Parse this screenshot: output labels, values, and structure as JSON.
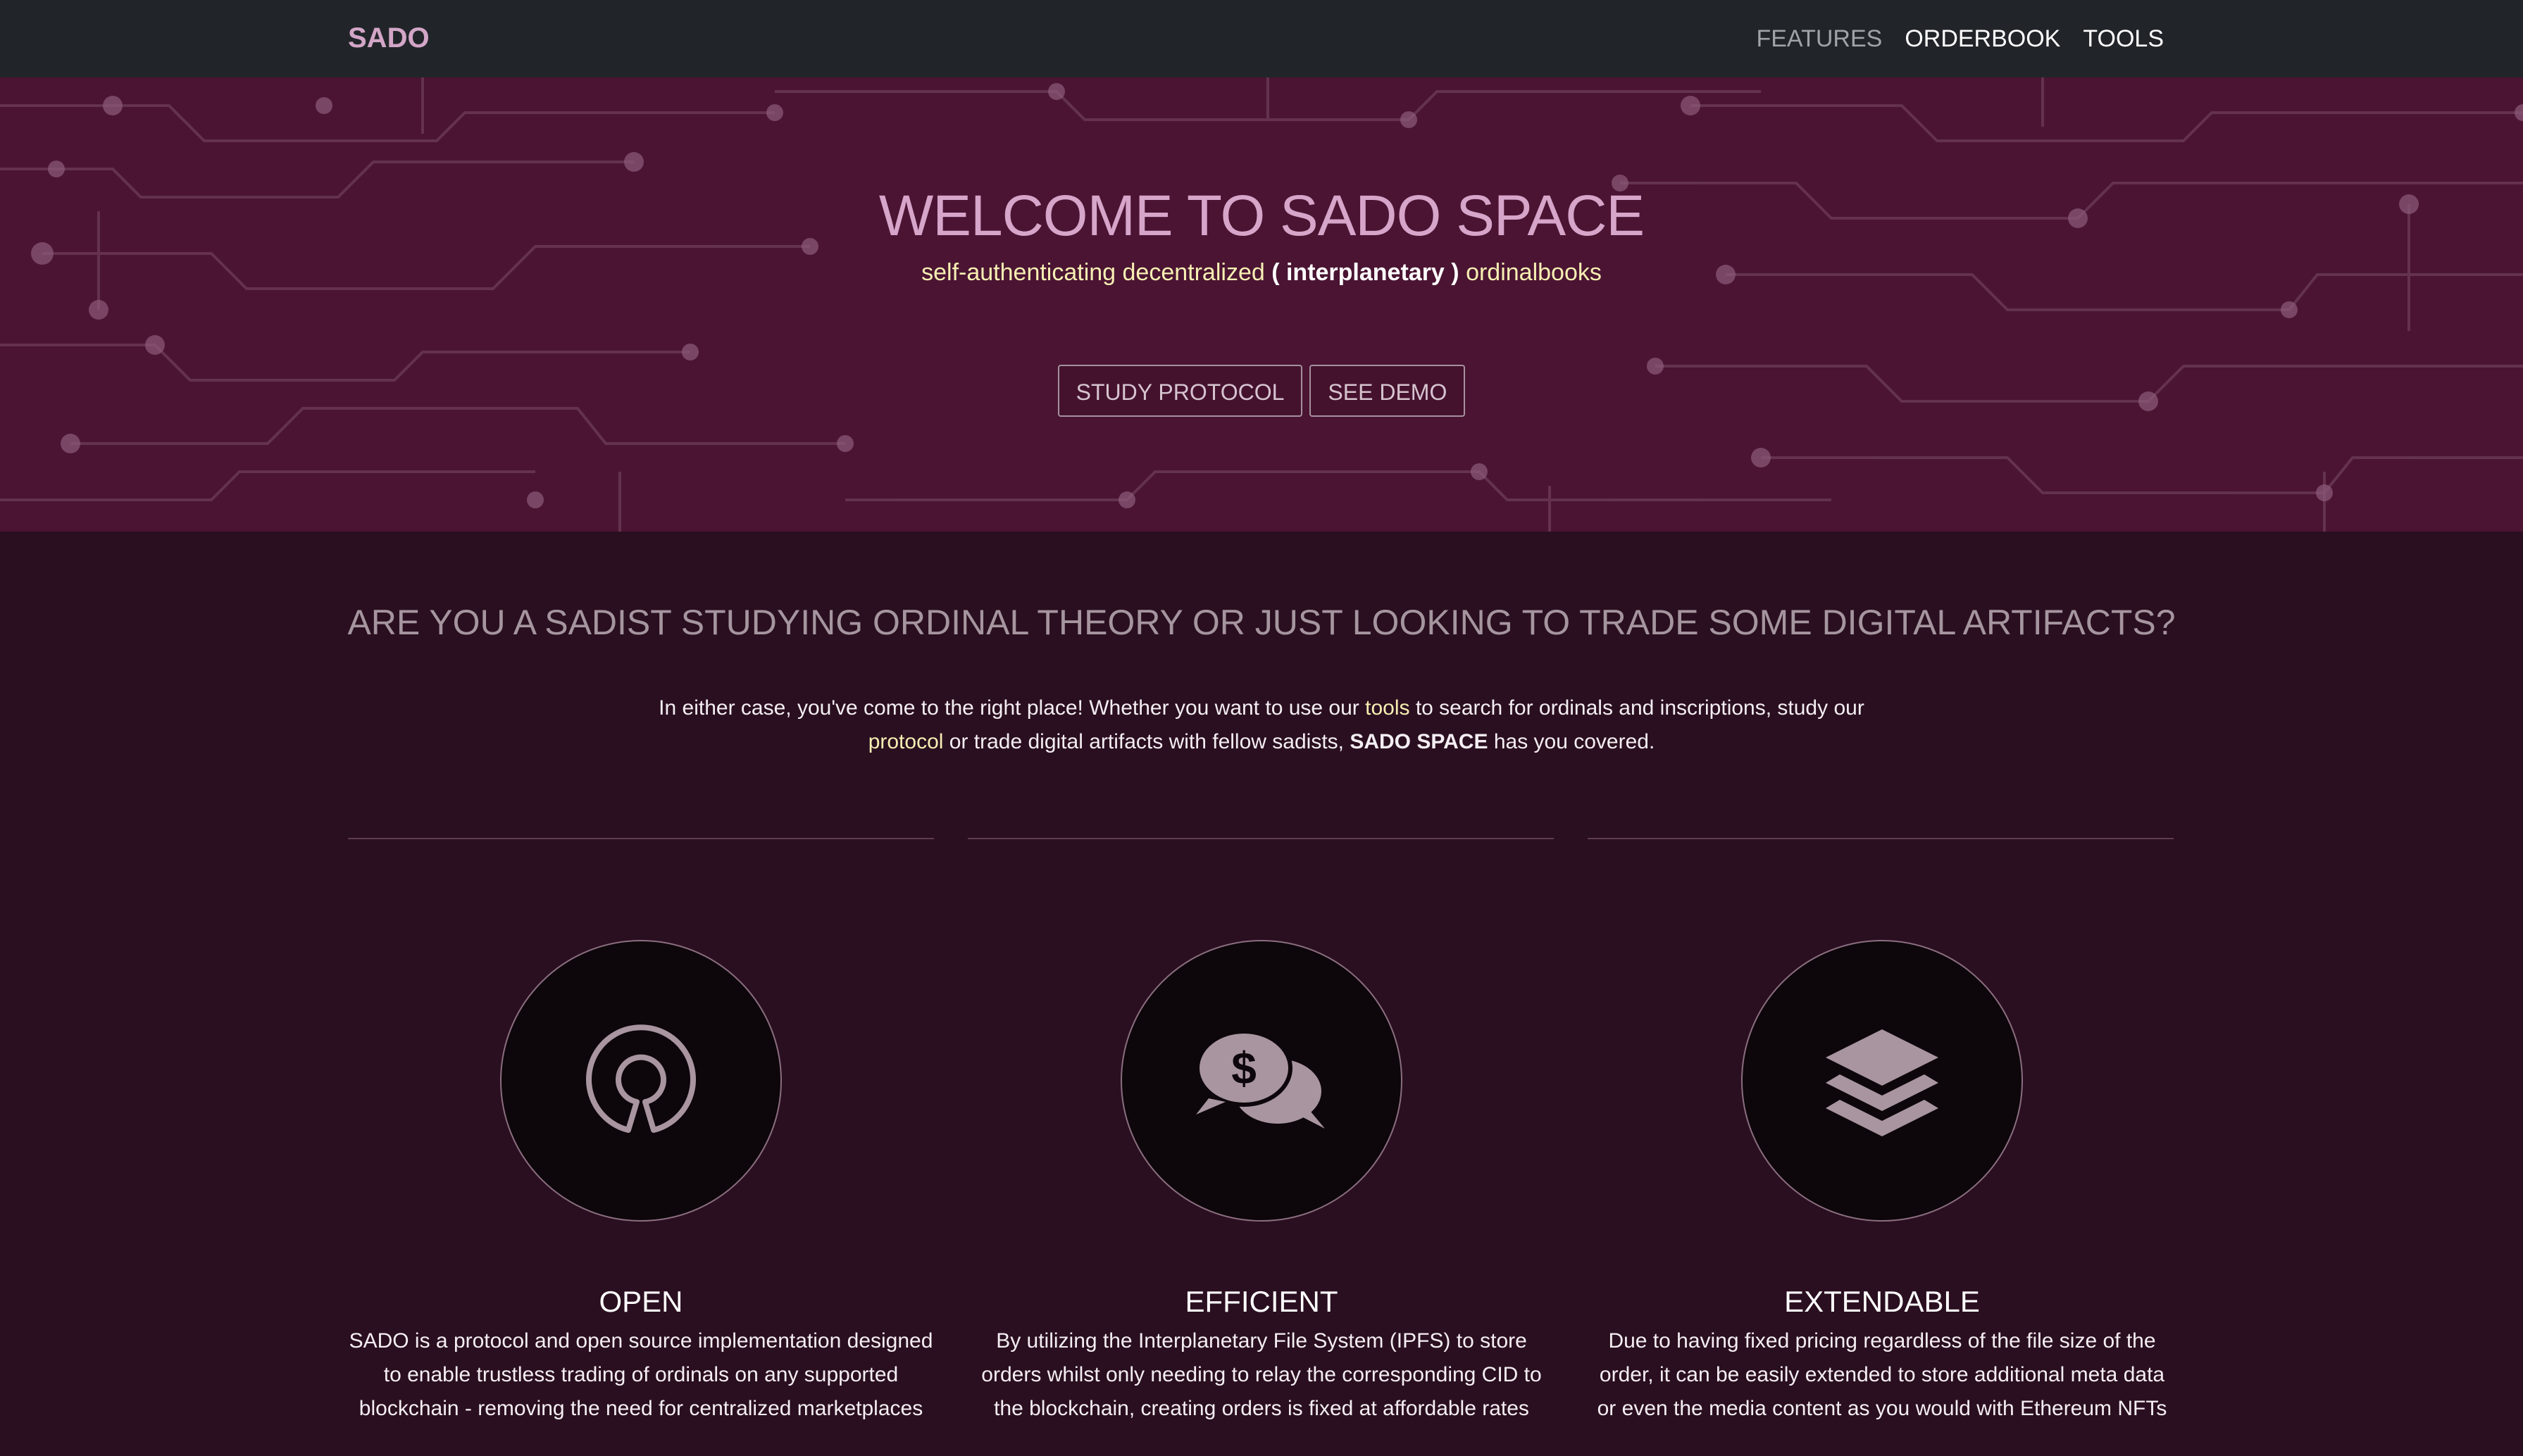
{
  "navbar": {
    "brand": "SADO",
    "links": [
      {
        "label": "FEATURES"
      },
      {
        "label": "ORDERBOOK"
      },
      {
        "label": "TOOLS"
      }
    ]
  },
  "hero": {
    "title": "WELCOME TO SADO SPACE",
    "subtitle_part1": "self-authenticating decentralized",
    "subtitle_part2": "( interplanetary )",
    "subtitle_part3": "ordinalbooks",
    "buttons": [
      {
        "label": "STUDY PROTOCOL"
      },
      {
        "label": "SEE DEMO"
      }
    ]
  },
  "intro": {
    "heading": "ARE YOU A SADIST STUDYING ORDINAL THEORY OR JUST LOOKING TO TRADE SOME DIGITAL ARTIFACTS?",
    "text1": "In either case, you've come to the right place! Whether you want to use our ",
    "link_tools": "tools",
    "text2": " to search for ordinals and inscriptions, study our ",
    "link_protocol": "protocol",
    "text3": " or trade digital artifacts with fellow sadists, ",
    "brand_bold": "SADO SPACE",
    "text4": " has you covered."
  },
  "features": [
    {
      "icon": "open-source-icon",
      "title": "OPEN",
      "text": "SADO is a protocol and open source implementation designed to enable trustless trading of ordinals on any supported blockchain - removing the need for centralized marketplaces"
    },
    {
      "icon": "dollar-chat-icon",
      "title": "EFFICIENT",
      "text": "By utilizing the Interplanetary File System (IPFS) to store orders whilst only needing to relay the corresponding CID to the blockchain, creating orders is fixed at affordable rates"
    },
    {
      "icon": "layers-icon",
      "title": "EXTENDABLE",
      "text": "Due to having fixed pricing regardless of the file size of the order, it can be easily extended to store additional meta data or even the media content as you would with Ethereum NFTs"
    }
  ],
  "colors": {
    "navbar_bg": "#212529",
    "hero_bg": "#4a1432",
    "page_bg": "#2a0f20",
    "accent_pink": "#d6a5c9",
    "accent_yellow": "#f7efb3"
  }
}
